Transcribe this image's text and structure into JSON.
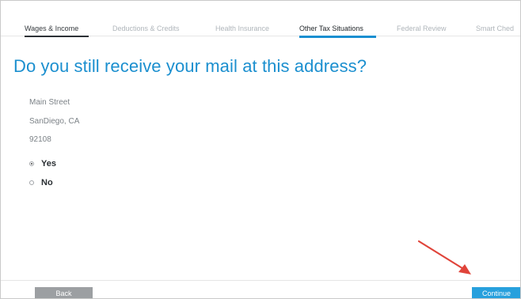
{
  "tabs": [
    {
      "label": "Wages & Income",
      "state": "done"
    },
    {
      "label": "Deductions & Credits",
      "state": "upcoming"
    },
    {
      "label": "Health Insurance",
      "state": "upcoming"
    },
    {
      "label": "Other Tax Situations",
      "state": "active"
    },
    {
      "label": "Federal Review",
      "state": "upcoming"
    },
    {
      "label": "Smart Ched",
      "state": "upcoming"
    }
  ],
  "question": "Do you still receive your mail at this address?",
  "address": {
    "line1": "Main Street",
    "line2": "SanDiego, CA",
    "line3": "92108"
  },
  "options": [
    {
      "label": "Yes",
      "selected": true
    },
    {
      "label": "No",
      "selected": false
    }
  ],
  "buttons": {
    "back": "Back",
    "continue": "Continue"
  },
  "colors": {
    "accent": "#1b8fcf",
    "annotation_arrow": "#e0443a",
    "back_button": "#9c9fa2",
    "continue_button": "#27a0dd"
  }
}
